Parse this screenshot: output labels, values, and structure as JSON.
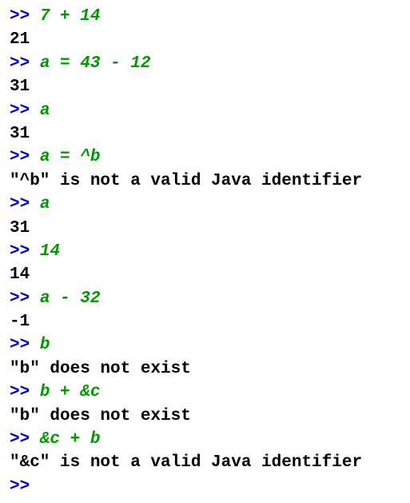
{
  "repl": {
    "prompt": ">> ",
    "lines": [
      {
        "type": "in",
        "text": "7 + 14"
      },
      {
        "type": "out",
        "text": "21"
      },
      {
        "type": "in",
        "text": "a = 43 - 12"
      },
      {
        "type": "out",
        "text": "31"
      },
      {
        "type": "in",
        "text": "a"
      },
      {
        "type": "out",
        "text": "31"
      },
      {
        "type": "in",
        "text": "a = ^b"
      },
      {
        "type": "out",
        "text": "\"^b\" is not a valid Java identifier"
      },
      {
        "type": "in",
        "text": "a"
      },
      {
        "type": "out",
        "text": "31"
      },
      {
        "type": "in",
        "text": "14"
      },
      {
        "type": "out",
        "text": "14"
      },
      {
        "type": "in",
        "text": "a - 32"
      },
      {
        "type": "out",
        "text": "-1"
      },
      {
        "type": "in",
        "text": "b"
      },
      {
        "type": "out",
        "text": "\"b\" does not exist"
      },
      {
        "type": "in",
        "text": "b + &c"
      },
      {
        "type": "out",
        "text": "\"b\" does not exist"
      },
      {
        "type": "in",
        "text": "&c + b"
      },
      {
        "type": "out",
        "text": "\"&c\" is not a valid Java identifier"
      },
      {
        "type": "in",
        "text": ""
      }
    ]
  }
}
